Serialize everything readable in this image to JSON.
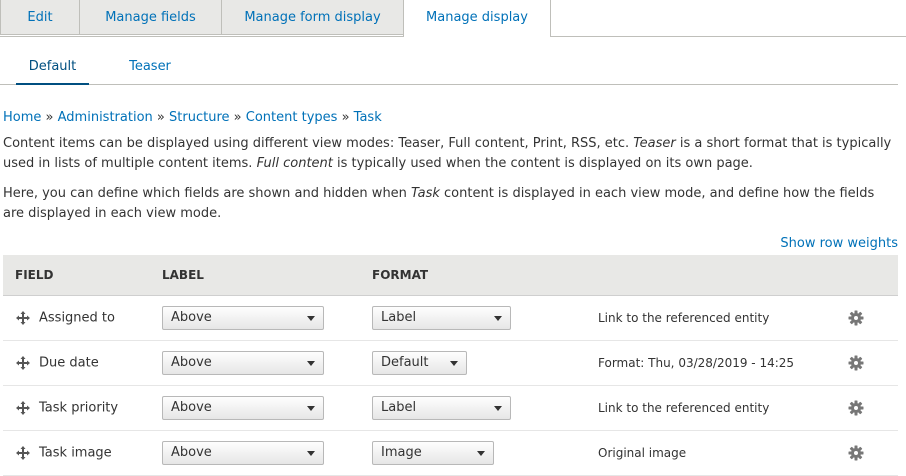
{
  "primary_tabs": [
    {
      "label": "Edit",
      "active": false
    },
    {
      "label": "Manage fields",
      "active": false
    },
    {
      "label": "Manage form display",
      "active": false
    },
    {
      "label": "Manage display",
      "active": true
    }
  ],
  "secondary_tabs": [
    {
      "label": "Default",
      "active": true
    },
    {
      "label": "Teaser",
      "active": false
    }
  ],
  "breadcrumb": {
    "items": [
      "Home",
      "Administration",
      "Structure",
      "Content types",
      "Task"
    ],
    "separator": "»"
  },
  "description": {
    "p1": {
      "part1": "Content items can be displayed using different view modes: Teaser, Full content, Print, RSS, etc. ",
      "em1": "Teaser",
      "part2": " is a short format that is typically used in lists of multiple content items. ",
      "em2": "Full content",
      "part3": " is typically used when the content is displayed on its own page."
    },
    "p2": {
      "part1": "Here, you can define which fields are shown and hidden when ",
      "em1": "Task",
      "part2": " content is displayed in each view mode, and define how the fields are displayed in each view mode."
    }
  },
  "show_row_weights": "Show row weights",
  "table": {
    "headers": {
      "field": "FIELD",
      "label": "LABEL",
      "format": "FORMAT"
    },
    "rows": [
      {
        "field": "Assigned to",
        "label": "Above",
        "format": "Label",
        "summary": "Link to the referenced entity"
      },
      {
        "field": "Due date",
        "label": "Above",
        "format": "Default",
        "summary": "Format: Thu, 03/28/2019 - 14:25"
      },
      {
        "field": "Task priority",
        "label": "Above",
        "format": "Label",
        "summary": "Link to the referenced entity"
      },
      {
        "field": "Task image",
        "label": "Above",
        "format": "Image",
        "summary": "Original image"
      }
    ]
  },
  "colors": {
    "link": "#0071b8",
    "tab_bg": "#e8e8e6",
    "header_bg": "#e8e8e6",
    "active_subtab": "#004f80"
  },
  "icons": {
    "drag": "move-handle-icon",
    "settings": "gear-icon",
    "dropdown": "caret-down-icon"
  }
}
